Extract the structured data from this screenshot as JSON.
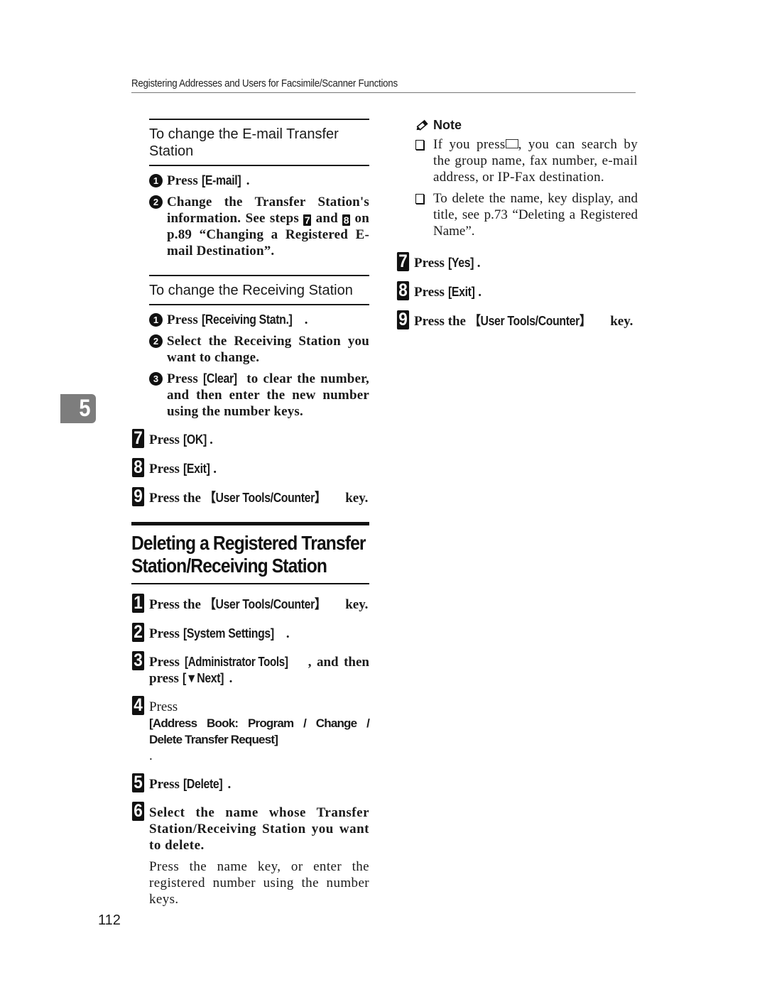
{
  "running_header": "Registering Addresses and Users for Facsimile/Scanner Functions",
  "chapter_tab": "5",
  "page_number": "112",
  "left_column": {
    "email_transfer": {
      "title": "To change the E-mail Transfer Station",
      "steps": [
        {
          "num": "1",
          "prefix": "Press ",
          "key": "[E-mail]",
          "suffix": "."
        },
        {
          "num": "2",
          "text_a": "Change the Transfer Station's information. See steps ",
          "ref1": "7",
          "text_b": " and ",
          "ref2": "8",
          "text_c": " on p.89 “Changing a Registered E-mail Destination”."
        }
      ]
    },
    "receiving_station": {
      "title": "To change the Receiving Station",
      "steps": [
        {
          "num": "1",
          "prefix": "Press ",
          "key": "[Receiving Statn.]",
          "suffix": "."
        },
        {
          "num": "2",
          "text": "Select the Receiving Station you want to change."
        },
        {
          "num": "3",
          "prefix": "Press ",
          "key": "[Clear]",
          "suffix": " to clear the number, and then enter the new number using the number keys."
        }
      ]
    },
    "main_steps": [
      {
        "num": "7",
        "prefix": "Press ",
        "key": "[OK]",
        "suffix": "."
      },
      {
        "num": "8",
        "prefix": "Press ",
        "key": "[Exit]",
        "suffix": "."
      },
      {
        "num": "9",
        "prefix": "Press the ",
        "key": "【User Tools/Counter】",
        "suffix": " key."
      }
    ],
    "section": {
      "heading": "Deleting a Registered Transfer Station/Receiving Station",
      "steps": [
        {
          "num": "1",
          "prefix": "Press the ",
          "key": "【User Tools/Counter】",
          "suffix": " key."
        },
        {
          "num": "2",
          "prefix": "Press ",
          "key": "[System Settings]",
          "suffix": "."
        },
        {
          "num": "3",
          "prefix": "Press ",
          "key": "[Administrator Tools]",
          "suffix": ", and then press ",
          "key2": "[▼Next]",
          "suffix2": "."
        },
        {
          "num": "4",
          "prefix": "Press ",
          "key": "[Address Book: Program / Change / Delete Transfer Request]",
          "suffix": "."
        },
        {
          "num": "5",
          "prefix": "Press ",
          "key": "[Delete]",
          "suffix": "."
        },
        {
          "num": "6",
          "text": "Select the name whose Transfer Station/Receiving Station you want to delete.",
          "note": "Press the name key, or enter the registered number using the number keys."
        }
      ]
    }
  },
  "right_column": {
    "note": {
      "title": "Note",
      "items": [
        {
          "text_a": "If you press",
          "icon": "search-key-icon",
          "text_b": ", you can search by the group name, fax number, e-mail address, or IP-Fax destination."
        },
        {
          "text": "To delete the name, key display, and title, see p.73 “Deleting a Registered Name”."
        }
      ]
    },
    "steps": [
      {
        "num": "7",
        "prefix": "Press ",
        "key": "[Yes]",
        "suffix": "."
      },
      {
        "num": "8",
        "prefix": "Press ",
        "key": "[Exit]",
        "suffix": "."
      },
      {
        "num": "9",
        "prefix": "Press the ",
        "key": "【User Tools/Counter】",
        "suffix": " key."
      }
    ]
  }
}
